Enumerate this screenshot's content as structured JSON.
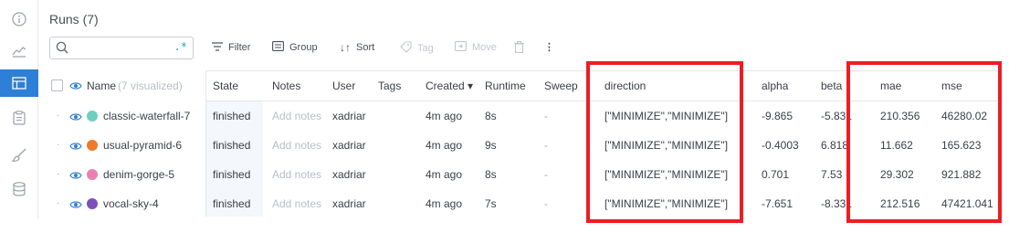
{
  "page": {
    "title": "Runs (7)"
  },
  "rail": {
    "icons": [
      "info-icon",
      "chart-icon",
      "table-icon",
      "clipboard-icon",
      "brush-icon",
      "database-icon"
    ]
  },
  "toolbar": {
    "search_placeholder": "",
    "regex_label": ".*",
    "filter_label": "Filter",
    "group_label": "Group",
    "sort_label": "Sort",
    "tag_label": "Tag",
    "move_label": "Move",
    "more_label": "⋮"
  },
  "table": {
    "name_header": "Name",
    "visualized_label": "(7 visualized)",
    "headers": {
      "state": "State",
      "notes": "Notes",
      "user": "User",
      "tags": "Tags",
      "created": "Created",
      "runtime": "Runtime",
      "sweep": "Sweep",
      "direction": "direction",
      "alpha": "alpha",
      "beta": "beta",
      "mae": "mae",
      "mse": "mse"
    },
    "created_sort_indicator": "▾",
    "rows": [
      {
        "name": "classic-waterfall-7",
        "color": "#6fcfbf",
        "state": "finished",
        "notes": "Add notes",
        "user": "xadriar",
        "tags": "",
        "created": "4m ago",
        "runtime": "8s",
        "sweep": "-",
        "direction": "[\"MINIMIZE\",\"MINIMIZE\"]",
        "alpha": "-9.865",
        "beta": "-5.831",
        "mae": "210.356",
        "mse": "46280.02"
      },
      {
        "name": "usual-pyramid-6",
        "color": "#f07a2c",
        "state": "finished",
        "notes": "Add notes",
        "user": "xadriar",
        "tags": "",
        "created": "4m ago",
        "runtime": "9s",
        "sweep": "-",
        "direction": "[\"MINIMIZE\",\"MINIMIZE\"]",
        "alpha": "-0.4003",
        "beta": "6.818",
        "mae": "11.662",
        "mse": "165.623"
      },
      {
        "name": "denim-gorge-5",
        "color": "#ee7fb1",
        "state": "finished",
        "notes": "Add notes",
        "user": "xadriar",
        "tags": "",
        "created": "4m ago",
        "runtime": "8s",
        "sweep": "-",
        "direction": "[\"MINIMIZE\",\"MINIMIZE\"]",
        "alpha": "0.701",
        "beta": "7.53",
        "mae": "29.302",
        "mse": "921.882"
      },
      {
        "name": "vocal-sky-4",
        "color": "#7a52b8",
        "state": "finished",
        "notes": "Add notes",
        "user": "xadriar",
        "tags": "",
        "created": "4m ago",
        "runtime": "7s",
        "sweep": "-",
        "direction": "[\"MINIMIZE\",\"MINIMIZE\"]",
        "alpha": "-7.651",
        "beta": "-8.331",
        "mae": "212.516",
        "mse": "47421.041"
      }
    ]
  },
  "colors": {
    "accent": "#2e7fd6",
    "highlight": "#ee1c24",
    "regex": "#2aa6b6"
  }
}
